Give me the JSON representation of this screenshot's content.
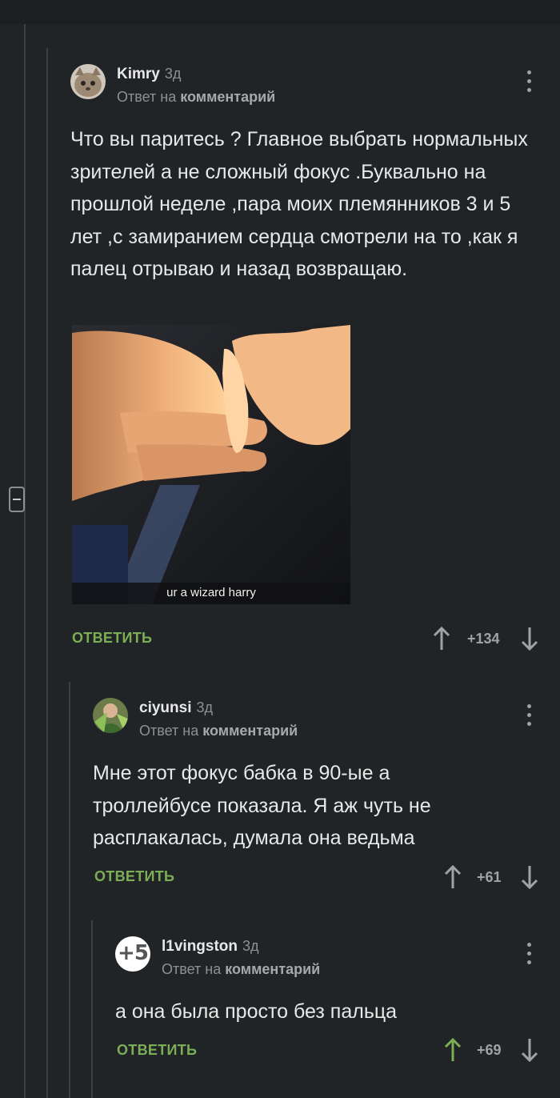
{
  "comments": [
    {
      "username": "Kimry",
      "age": "3д",
      "reply_prefix": "Ответ на",
      "reply_target": "комментарий",
      "text": "Что вы паритесь ? Главное выбрать нормальных зрителей а не сложный фокус .Буквально на прошлой неделе ,пара моих племянников 3 и 5 лет ,с замиранием сердца смотрели на то ,как я палец отрываю и назад возвращаю.",
      "media_caption": "ur a wizard harry",
      "reply_label": "ОТВЕТИТЬ",
      "score": "+134"
    },
    {
      "username": "ciyunsi",
      "age": "3д",
      "reply_prefix": "Ответ на",
      "reply_target": "комментарий",
      "text": "Мне этот фокус бабка в 90-ые а троллейбусе показала. Я аж чуть не расплакалась, думала она ведьма",
      "reply_label": "ОТВЕТИТЬ",
      "score": "+61"
    },
    {
      "username": "l1vingston",
      "age": "3д",
      "avatar_text": "+5",
      "reply_prefix": "Ответ на",
      "reply_target": "комментарий",
      "text": "а она была просто без пальца",
      "reply_label": "ОТВЕТИТЬ",
      "score": "+69"
    }
  ],
  "icons": [
    "collapse-thread-icon",
    "more-options-icon",
    "upvote-arrow-icon",
    "downvote-arrow-icon"
  ],
  "colors": {
    "background": "#212426",
    "accent": "#7cae56",
    "muted": "#8c9196",
    "upvoted": "#7cae56"
  }
}
